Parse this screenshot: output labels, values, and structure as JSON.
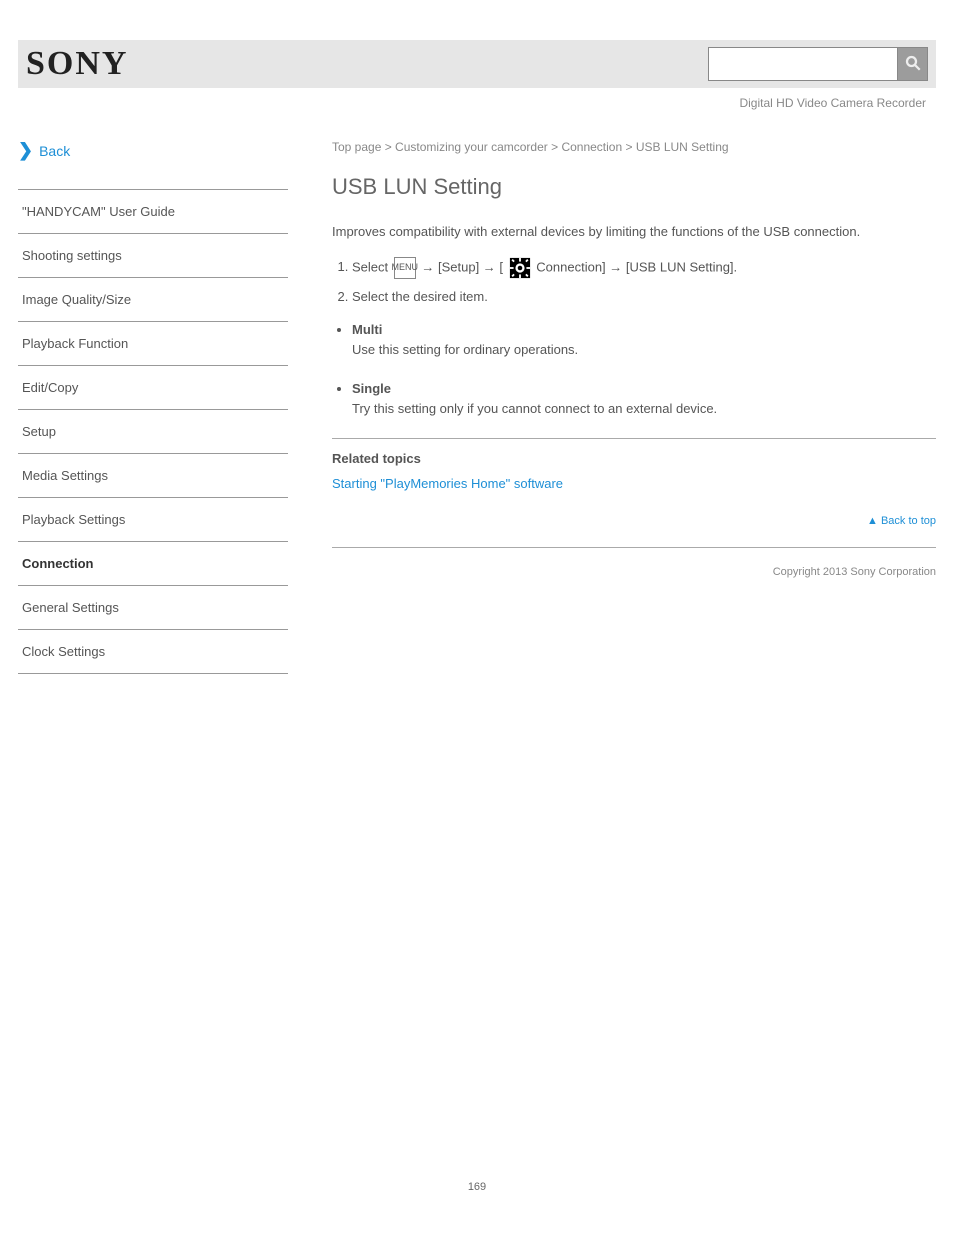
{
  "header": {
    "logo_text": "SONY",
    "product_name": "Digital HD Video Camera Recorder",
    "search_placeholder": ""
  },
  "sidebar": {
    "back_link": "Back",
    "items": [
      "\"HANDYCAM\" User Guide",
      "Shooting settings",
      "Image Quality/Size",
      "Playback Function",
      "Edit/Copy",
      "Setup",
      "Media Settings",
      "Playback Settings",
      "Connection"
    ],
    "sub_items": [
      "General Settings",
      "Clock Settings"
    ],
    "selected_index": 8
  },
  "content": {
    "breadcrumb": "Top page > Customizing your camcorder > Connection > USB LUN Setting",
    "title": "USB LUN Setting",
    "intro": "Improves compatibility with external devices by limiting the functions of the USB connection.",
    "step_prefix": "Select ",
    "step_line_1a": " → [Setup] → [",
    "step_line_1b": " Connection] → [USB LUN Setting].",
    "step_line_2": "Select the desired item.",
    "options": [
      {
        "name": "Multi",
        "desc": "Use this setting for ordinary operations."
      },
      {
        "name": "Single",
        "desc": "Try this setting only if you cannot connect to an external device."
      }
    ],
    "related_heading": "Related topics",
    "related_links": [
      "Starting \"PlayMemories Home\" software"
    ],
    "back_to_top": "▲ Back to top",
    "copyright": "Copyright 2013 Sony Corporation"
  },
  "page_number": "169"
}
